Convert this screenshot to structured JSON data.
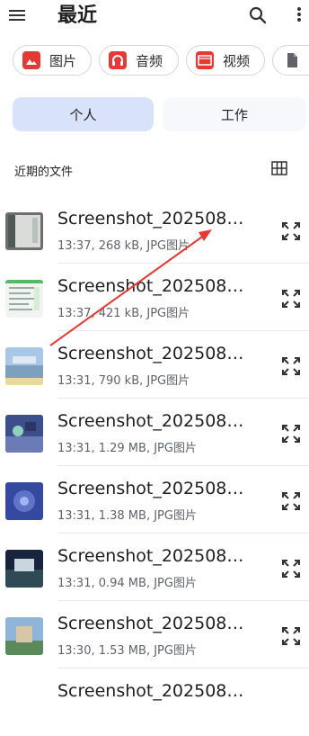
{
  "header": {
    "title": "最近"
  },
  "chips": [
    {
      "label": "图片",
      "icon": "image-icon",
      "color": "#e53935"
    },
    {
      "label": "音频",
      "icon": "headphones-icon",
      "color": "#e53935"
    },
    {
      "label": "视频",
      "icon": "video-icon",
      "color": "#e53935"
    },
    {
      "label": "",
      "icon": "document-icon",
      "color": "#5f6368"
    }
  ],
  "tabs": [
    {
      "label": "个人",
      "active": true
    },
    {
      "label": "工作",
      "active": false
    }
  ],
  "section": {
    "title": "近期的文件"
  },
  "files": [
    {
      "name": "Screenshot_202508…",
      "meta": "13:37, 268 kB, JPG图片"
    },
    {
      "name": "Screenshot_202508…",
      "meta": "13:37, 421 kB, JPG图片"
    },
    {
      "name": "Screenshot_202508…",
      "meta": "13:31, 790 kB, JPG图片"
    },
    {
      "name": "Screenshot_202508…",
      "meta": "13:31, 1.29 MB, JPG图片"
    },
    {
      "name": "Screenshot_202508…",
      "meta": "13:31, 1.38 MB, JPG图片"
    },
    {
      "name": "Screenshot_202508…",
      "meta": "13:31, 0.94 MB, JPG图片"
    },
    {
      "name": "Screenshot_202508…",
      "meta": "13:30, 1.53 MB, JPG图片"
    },
    {
      "name": "Screenshot_202508…",
      "meta": ""
    }
  ],
  "colors": {
    "accent_tab": "#d8e2fb",
    "annotation_arrow": "#e53935"
  }
}
